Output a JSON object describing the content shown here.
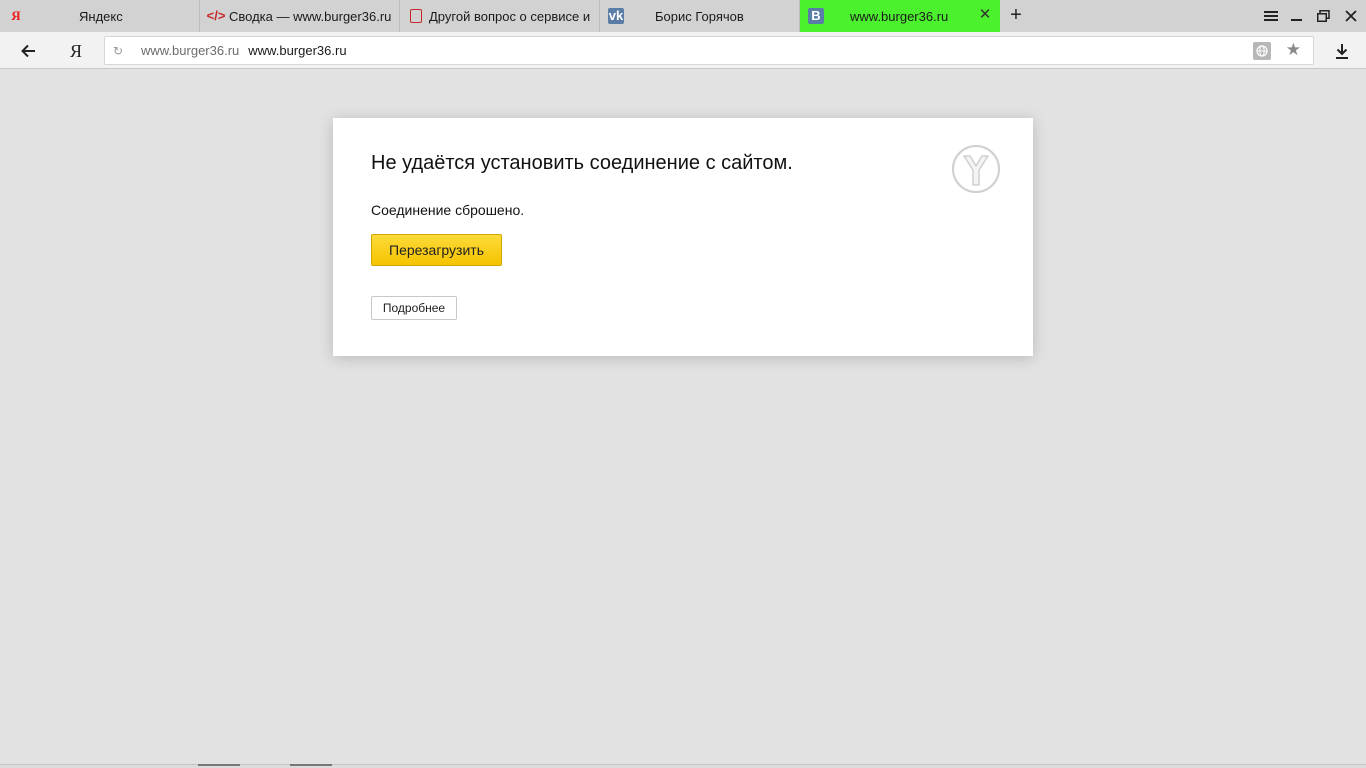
{
  "tabs": [
    {
      "title": "Яндекс",
      "favicon": "yandex-logo-icon",
      "favicon_glyph": "Я"
    },
    {
      "title": "Сводка — www.burger36.ru",
      "favicon": "code-icon",
      "favicon_glyph": "</>"
    },
    {
      "title": "Другой вопрос о сервисе и",
      "favicon": "document-icon",
      "favicon_glyph": ""
    },
    {
      "title": "Борис Горячов",
      "favicon": "vk-icon",
      "favicon_glyph": "vk"
    },
    {
      "title": "www.burger36.ru",
      "favicon": "b-icon",
      "favicon_glyph": "B",
      "active": true,
      "active_color": "#4cf12e"
    }
  ],
  "toolbar": {
    "new_tab_glyph": "+",
    "yandex_glyph": "Я"
  },
  "omnibox": {
    "host": "www.burger36.ru",
    "url": "www.burger36.ru"
  },
  "error": {
    "heading": "Не удаётся установить соединение с сайтом.",
    "message": "Соединение сброшено.",
    "reload_label": "Перезагрузить",
    "details_label": "Подробнее"
  },
  "colors": {
    "page_bg": "#e2e2e2",
    "reload_button": "#fad12a",
    "active_tab": "#4cf12e"
  }
}
